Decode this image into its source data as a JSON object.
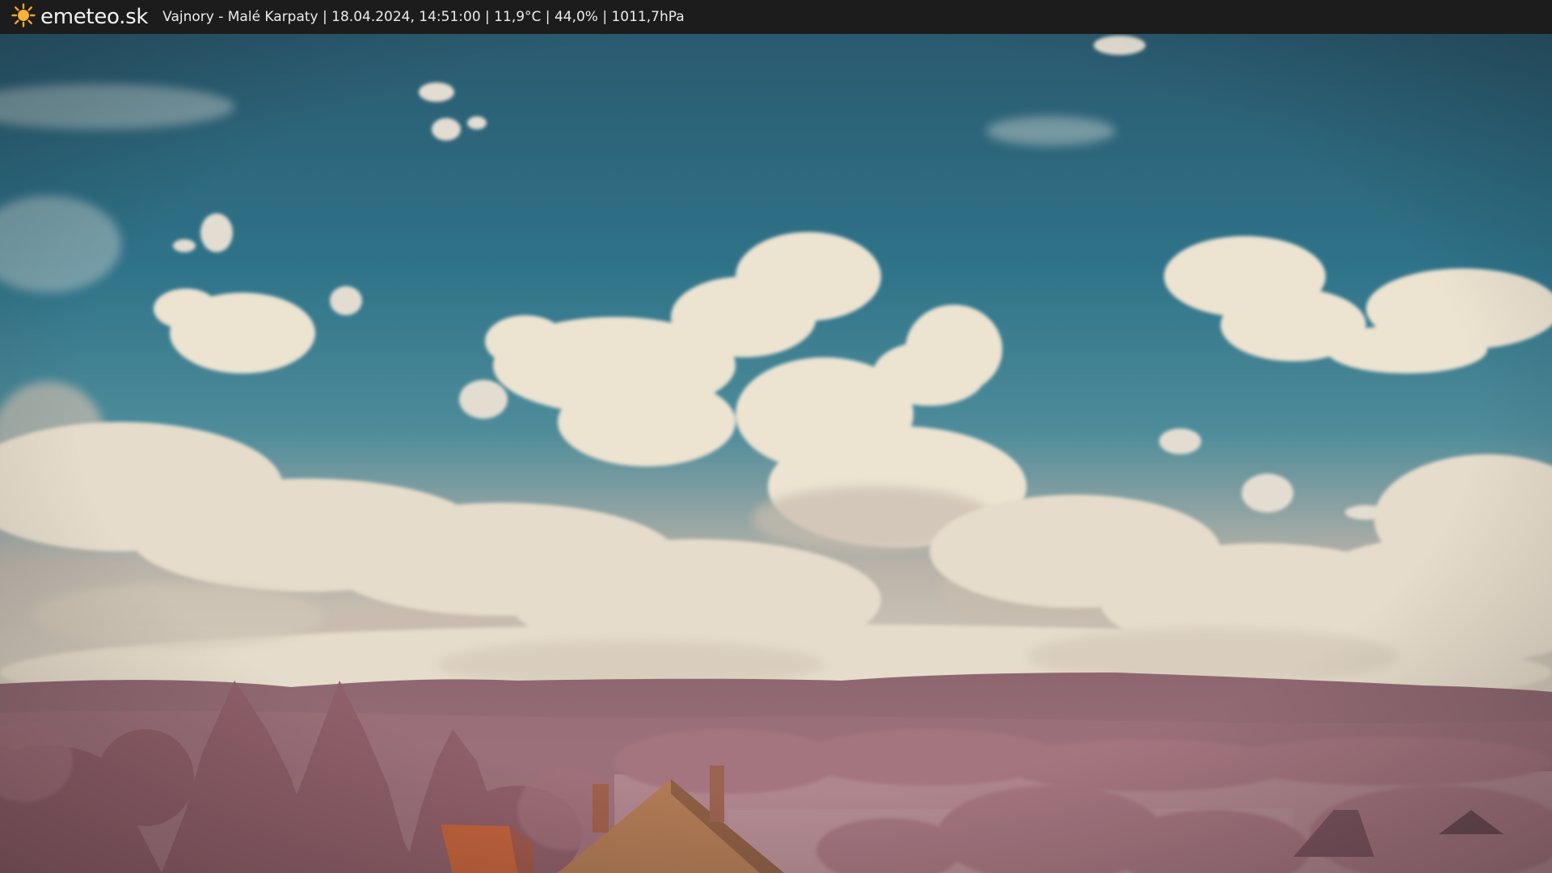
{
  "header": {
    "logo_text": "emeteo.sk",
    "caption": "Vajnory - Malé Karpaty | 18.04.2024, 14:51:00 | 11,9°C | 44,0% | 1011,7hPa"
  },
  "icons": {
    "logo": "sun-icon"
  },
  "colors": {
    "topbar": "#1c1c1c",
    "sun": "#f3a52b",
    "sky_top": "#2d5f74",
    "sky_mid": "#2f7d92",
    "cloud": "#ede4d3",
    "hills": "#9b6f78",
    "foliage": "#a87881",
    "roof": "#c4643d"
  }
}
